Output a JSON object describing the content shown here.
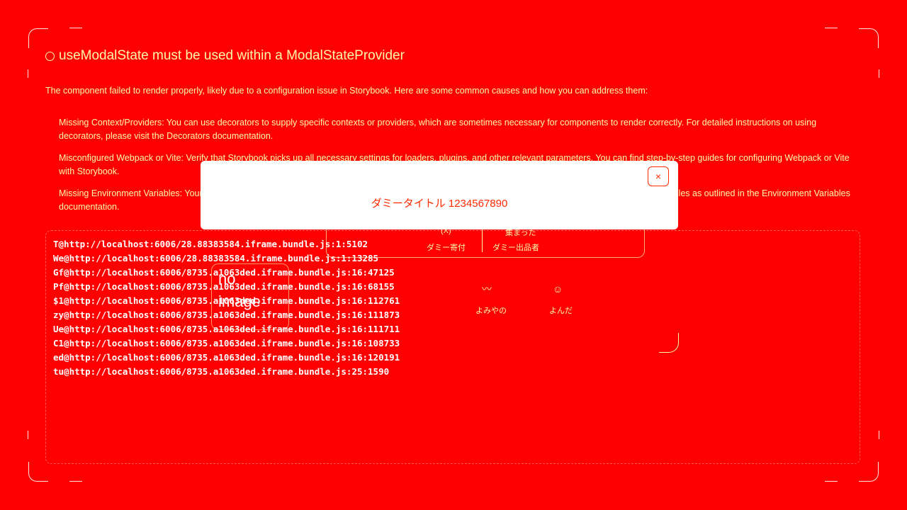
{
  "error": {
    "title": "useModalState must be used within a ModalStateProvider",
    "intro": "The component failed to render properly, likely due to a configuration issue in Storybook. Here are some common causes and how you can address them:",
    "causes": [
      "Missing Context/Providers: You can use decorators to supply specific contexts or providers, which are sometimes necessary for components to render correctly. For detailed instructions on using decorators, please visit the Decorators documentation.",
      "Misconfigured Webpack or Vite: Verify that Storybook picks up all necessary settings for loaders, plugins, and other relevant parameters. You can find step-by-step guides for configuring Webpack or Vite with Storybook.",
      "Missing Environment Variables: Your Storybook may require specific environment variables to function as intended. You can set up custom environment variables as outlined in the Environment Variables documentation."
    ],
    "stack": [
      "T@http://localhost:6006/28.88383584.iframe.bundle.js:1:5102",
      "We@http://localhost:6006/28.88383584.iframe.bundle.js:1:13285",
      "Gf@http://localhost:6006/8735.a1063ded.iframe.bundle.js:16:47125",
      "Pf@http://localhost:6006/8735.a1063ded.iframe.bundle.js:16:68155",
      "$1@http://localhost:6006/8735.a1063ded.iframe.bundle.js:16:112761",
      "zy@http://localhost:6006/8735.a1063ded.iframe.bundle.js:16:111873",
      "Ue@http://localhost:6006/8735.a1063ded.iframe.bundle.js:16:111711",
      "C1@http://localhost:6006/8735.a1063ded.iframe.bundle.js:16:108733",
      "ed@http://localhost:6006/8735.a1063ded.iframe.bundle.js:16:120191",
      "tu@http://localhost:6006/8735.a1063ded.iframe.bundle.js:25:1590"
    ]
  },
  "modal": {
    "title": "ダミータイトル 1234567890",
    "close_symbol": "×",
    "stat_left_top": "(X)",
    "stat_left_label": "ダミー寄付",
    "stat_right_top": "集まった",
    "stat_right_label": "ダミー出品者",
    "no_image_line1": "no",
    "no_image_line2": "image",
    "icon_left_label": "よみやの",
    "icon_right_label": "よんだ"
  },
  "colors": {
    "background": "#ff0000",
    "text": "#fff7a8",
    "modal_bg": "#ffffff",
    "accent": "#ff2a00"
  }
}
